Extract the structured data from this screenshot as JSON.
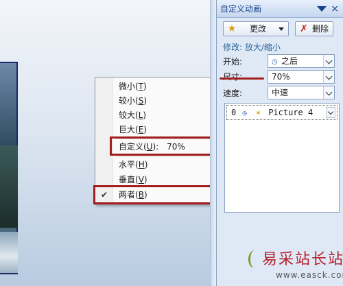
{
  "context_menu": {
    "items": [
      {
        "text": "微小",
        "key": "T"
      },
      {
        "text": "较小",
        "key": "S"
      },
      {
        "text": "较大",
        "key": "L"
      },
      {
        "text": "巨大",
        "key": "E"
      },
      {
        "text": "自定义",
        "key": "U",
        "value": "70%"
      },
      {
        "text": "水平",
        "key": "H"
      },
      {
        "text": "垂直",
        "key": "V"
      },
      {
        "text": "两者",
        "key": "B",
        "checked": true
      }
    ],
    "check_glyph": "✔"
  },
  "pane": {
    "title": "自定义动画",
    "change_button": "更改",
    "remove_button": "删除",
    "effect_label": "修改: 放大/缩小",
    "start_label": "开始:",
    "start_value": "之后",
    "size_label": "尺寸:",
    "size_value": "70%",
    "speed_label": "速度:",
    "speed_value": "中速",
    "list_item": {
      "number": "0",
      "name": "Picture 4"
    }
  },
  "watermark": {
    "title": "易采站长站",
    "url": "www.easck.com"
  },
  "colors": {
    "highlight_red": "#a31d1d",
    "pane_title": "#15428b"
  }
}
